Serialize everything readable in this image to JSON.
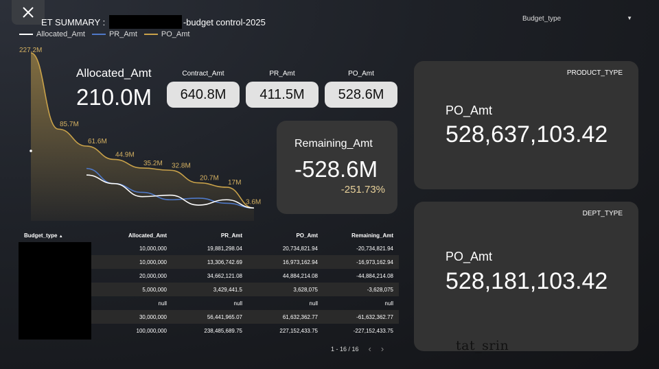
{
  "header": {
    "title_prefix": "ET SUMMARY :",
    "title_suffix": "-budget control-2025",
    "filter_label": "Budget_type"
  },
  "legend": [
    {
      "name": "Allocated_Amt",
      "color": "#ffffff"
    },
    {
      "name": "PR_Amt",
      "color": "#4f79c8"
    },
    {
      "name": "PO_Amt",
      "color": "#c9a24a"
    }
  ],
  "chart_data": {
    "type": "line",
    "x": [
      "1",
      "2",
      "3",
      "4",
      "5",
      "6",
      "7",
      "8",
      "9"
    ],
    "series": [
      {
        "name": "PO_Amt",
        "values": [
          227.2,
          85.7,
          61.6,
          44.9,
          35.2,
          32.8,
          20.7,
          17,
          3.6
        ]
      },
      {
        "name": "PR_Amt",
        "values": [
          null,
          null,
          34.7,
          20,
          13,
          8,
          9,
          6,
          3.6
        ]
      },
      {
        "name": "Allocated_Amt",
        "values": [
          null,
          null,
          28,
          20,
          10,
          11,
          5,
          8,
          3.6
        ]
      }
    ],
    "data_labels": [
      "227.2M",
      "85.7M",
      "61.6M",
      "44.9M",
      "35.2M",
      "32.8M",
      "20.7M",
      "17M",
      "3.6M"
    ],
    "ylim": [
      0,
      235
    ]
  },
  "kpis": {
    "allocated_label": "Allocated_Amt",
    "allocated_value": "210.0M",
    "contract_label": "Contract_Amt",
    "contract_value": "640.8M",
    "pr_label": "PR_Amt",
    "pr_value": "411.5M",
    "po_label": "PO_Amt",
    "po_value": "528.6M",
    "remaining_label": "Remaining_Amt",
    "remaining_value": "-528.6M",
    "remaining_pct": "-251.73%"
  },
  "product_card": {
    "tag": "PRODUCT_TYPE",
    "label": "PO_Amt",
    "value": "528,637,103.42"
  },
  "dept_card": {
    "tag": "DEPT_TYPE",
    "label": "PO_Amt",
    "value": "528,181,103.42"
  },
  "table": {
    "sort_indicator": "▲",
    "headers": [
      "Budget_type",
      "Allocated_Amt",
      "PR_Amt",
      "PO_Amt",
      "Remaining_Amt"
    ],
    "rows": [
      [
        "",
        "10,000,000",
        "19,881,298.04",
        "20,734,821.94",
        "-20,734,821.94"
      ],
      [
        "",
        "10,000,000",
        "13,306,742.69",
        "16,973,162.94",
        "-16,973,162.94"
      ],
      [
        "",
        "20,000,000",
        "34,662,121.08",
        "44,884,214.08",
        "-44,884,214.08"
      ],
      [
        "",
        "5,000,000",
        "3,429,441.5",
        "3,628,075",
        "-3,628,075"
      ],
      [
        "",
        "null",
        "null",
        "null",
        "null"
      ],
      [
        "",
        "30,000,000",
        "56,441,965.07",
        "61,632,362.77",
        "-61,632,362.77"
      ],
      [
        "",
        "100,000,000",
        "238,485,689.75",
        "227,152,433.75",
        "-227,152,433.75"
      ]
    ]
  },
  "pager": {
    "text": "1 - 16 / 16",
    "prev": "‹",
    "next": "›"
  },
  "signature": "tat_srin"
}
